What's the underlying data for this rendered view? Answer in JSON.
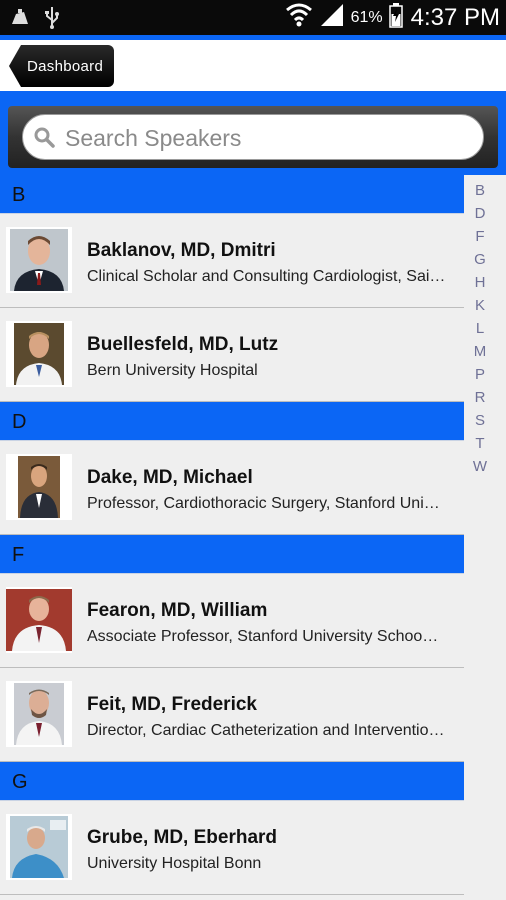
{
  "status_bar": {
    "battery": "61%",
    "time": "4:37 PM",
    "icons": [
      "notification-icon",
      "usb-icon",
      "wifi-icon",
      "signal-icon",
      "battery-icon"
    ]
  },
  "header": {
    "back_label": "Dashboard"
  },
  "search": {
    "placeholder": "Search Speakers"
  },
  "colors": {
    "accent": "#0b66f5",
    "status_bar": "#0a0a0a",
    "index_letters": "#6f7196"
  },
  "sections": [
    {
      "letter": "B",
      "speakers": [
        {
          "name": "Baklanov, MD, Dmitri",
          "title": "Clinical Scholar and Consulting Cardiologist, Sai…"
        },
        {
          "name": "Buellesfeld, MD, Lutz",
          "title": "Bern University Hospital"
        }
      ]
    },
    {
      "letter": "D",
      "speakers": [
        {
          "name": "Dake, MD, Michael",
          "title": "Professor, Cardiothoracic Surgery, Stanford Uni…"
        }
      ]
    },
    {
      "letter": "F",
      "speakers": [
        {
          "name": "Fearon, MD, William",
          "title": "Associate Professor, Stanford University Schoo…"
        },
        {
          "name": "Feit, MD, Frederick",
          "title": "Director, Cardiac Catheterization and Interventio…"
        }
      ]
    },
    {
      "letter": "G",
      "speakers": [
        {
          "name": "Grube, MD, Eberhard",
          "title": "University Hospital Bonn"
        }
      ]
    }
  ],
  "index_letters": [
    "B",
    "D",
    "F",
    "G",
    "H",
    "K",
    "L",
    "M",
    "P",
    "R",
    "S",
    "T",
    "W"
  ]
}
